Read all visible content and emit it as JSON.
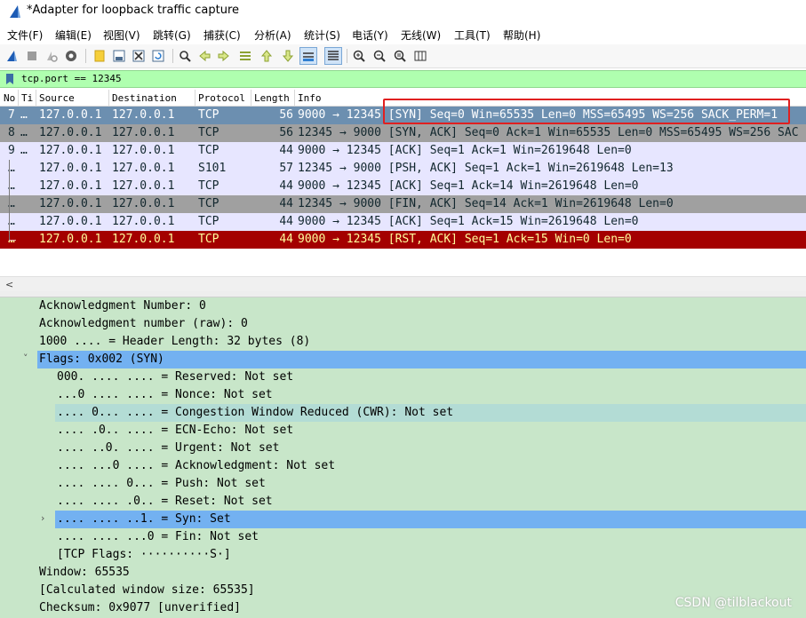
{
  "window": {
    "title": "*Adapter for loopback traffic capture"
  },
  "menu": [
    "文件(F)",
    "编辑(E)",
    "视图(V)",
    "跳转(G)",
    "捕获(C)",
    "分析(A)",
    "统计(S)",
    "电话(Y)",
    "无线(W)",
    "工具(T)",
    "帮助(H)"
  ],
  "toolbar": {
    "icons": [
      "shark-fin-icon",
      "stop-icon",
      "restart-icon",
      "options-gear-icon",
      "open-folder-icon",
      "save-icon",
      "close-file-icon",
      "reload-icon",
      "find-icon",
      "go-back-icon",
      "go-forward-icon",
      "go-to-packet-icon",
      "go-first-icon",
      "go-last-icon",
      "autoscroll-icon",
      "colorize-icon",
      "zoom-in-icon",
      "zoom-out-icon",
      "zoom-normal-icon",
      "resize-columns-icon"
    ]
  },
  "filter": {
    "value": "tcp.port == 12345"
  },
  "packet_list": {
    "columns": [
      "No",
      "Ti",
      "Source",
      "Destination",
      "Protocol",
      "Length",
      "Info"
    ],
    "rows": [
      {
        "no": "7",
        "time": "…",
        "src": "127.0.0.1",
        "dst": "127.0.0.1",
        "proto": "TCP",
        "len": "56",
        "info": "9000 → 12345 [SYN] Seq=0 Win=65535 Len=0 MSS=65495 WS=256 SACK_PERM=1",
        "bg": "#6c8fb0",
        "fg": "#ffffff"
      },
      {
        "no": "8",
        "time": "…",
        "src": "127.0.0.1",
        "dst": "127.0.0.1",
        "proto": "TCP",
        "len": "56",
        "info": "12345 → 9000 [SYN, ACK] Seq=0 Ack=1 Win=65535 Len=0 MSS=65495 WS=256 SAC",
        "bg": "#a0a0a0",
        "fg": "#12272e"
      },
      {
        "no": "9",
        "time": "…",
        "src": "127.0.0.1",
        "dst": "127.0.0.1",
        "proto": "TCP",
        "len": "44",
        "info": "9000 → 12345 [ACK] Seq=1 Ack=1 Win=2619648 Len=0",
        "bg": "#e7e6ff",
        "fg": "#12272e"
      },
      {
        "no": "…",
        "time": "",
        "src": "127.0.0.1",
        "dst": "127.0.0.1",
        "proto": "S101",
        "len": "57",
        "info": "12345 → 9000 [PSH, ACK] Seq=1 Ack=1 Win=2619648 Len=13",
        "bg": "#e7e6ff",
        "fg": "#12272e"
      },
      {
        "no": "…",
        "time": "",
        "src": "127.0.0.1",
        "dst": "127.0.0.1",
        "proto": "TCP",
        "len": "44",
        "info": "9000 → 12345 [ACK] Seq=1 Ack=14 Win=2619648 Len=0",
        "bg": "#e7e6ff",
        "fg": "#12272e"
      },
      {
        "no": "…",
        "time": "",
        "src": "127.0.0.1",
        "dst": "127.0.0.1",
        "proto": "TCP",
        "len": "44",
        "info": "12345 → 9000 [FIN, ACK] Seq=14 Ack=1 Win=2619648 Len=0",
        "bg": "#a0a0a0",
        "fg": "#12272e"
      },
      {
        "no": "…",
        "time": "",
        "src": "127.0.0.1",
        "dst": "127.0.0.1",
        "proto": "TCP",
        "len": "44",
        "info": "9000 → 12345 [ACK] Seq=1 Ack=15 Win=2619648 Len=0",
        "bg": "#e7e6ff",
        "fg": "#12272e"
      },
      {
        "no": "…",
        "time": "",
        "src": "127.0.0.1",
        "dst": "127.0.0.1",
        "proto": "TCP",
        "len": "44",
        "info": "9000 → 12345 [RST, ACK] Seq=1 Ack=15 Win=0 Len=0",
        "bg": "#a40000",
        "fg": "#fffc9c"
      }
    ]
  },
  "details": {
    "lines": [
      {
        "text": "Acknowledgment Number: 0",
        "indent": 0,
        "expander": "",
        "style": ""
      },
      {
        "text": "Acknowledgment number (raw): 0",
        "indent": 0,
        "expander": "",
        "style": ""
      },
      {
        "text": "1000 .... = Header Length: 32 bytes (8)",
        "indent": 0,
        "expander": "",
        "style": ""
      },
      {
        "text": "Flags: 0x002 (SYN)",
        "indent": 0,
        "expander": "˅",
        "style": "sel"
      },
      {
        "text": "000. .... .... = Reserved: Not set",
        "indent": 1,
        "expander": "",
        "style": ""
      },
      {
        "text": "...0 .... .... = Nonce: Not set",
        "indent": 1,
        "expander": "",
        "style": ""
      },
      {
        "text": ".... 0... .... = Congestion Window Reduced (CWR): Not set",
        "indent": 1,
        "expander": "",
        "style": "soft"
      },
      {
        "text": ".... .0.. .... = ECN-Echo: Not set",
        "indent": 1,
        "expander": "",
        "style": ""
      },
      {
        "text": ".... ..0. .... = Urgent: Not set",
        "indent": 1,
        "expander": "",
        "style": ""
      },
      {
        "text": ".... ...0 .... = Acknowledgment: Not set",
        "indent": 1,
        "expander": "",
        "style": ""
      },
      {
        "text": ".... .... 0... = Push: Not set",
        "indent": 1,
        "expander": "",
        "style": ""
      },
      {
        "text": ".... .... .0.. = Reset: Not set",
        "indent": 1,
        "expander": "",
        "style": ""
      },
      {
        "text": ".... .... ..1. = Syn: Set",
        "indent": 1,
        "expander": "›",
        "style": "sel"
      },
      {
        "text": ".... .... ...0 = Fin: Not set",
        "indent": 1,
        "expander": "",
        "style": ""
      },
      {
        "text": "[TCP Flags: ··········S·]",
        "indent": 1,
        "expander": "",
        "style": ""
      },
      {
        "text": "Window: 65535",
        "indent": 0,
        "expander": "",
        "style": ""
      },
      {
        "text": "[Calculated window size: 65535]",
        "indent": 0,
        "expander": "",
        "style": ""
      },
      {
        "text": "Checksum: 0x9077 [unverified]",
        "indent": 0,
        "expander": "",
        "style": ""
      }
    ]
  },
  "watermark": "CSDN @tilblackout"
}
